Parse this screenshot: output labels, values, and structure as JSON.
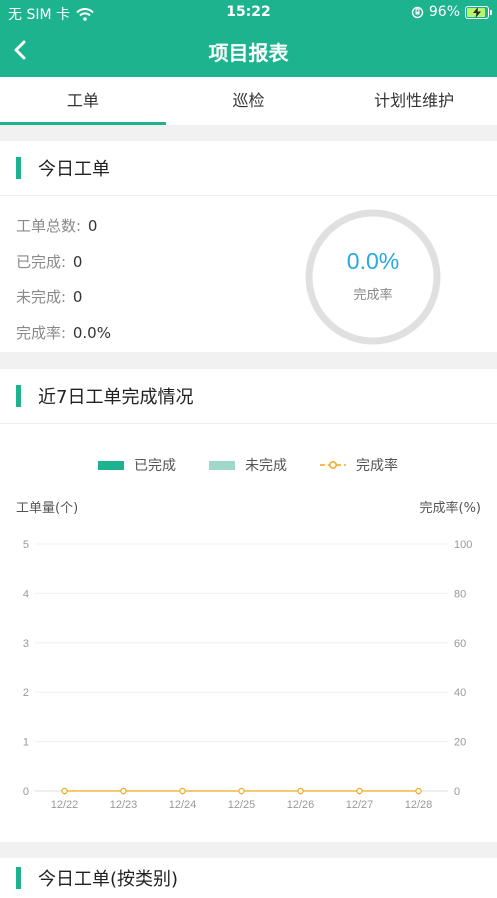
{
  "status_bar": {
    "carrier": "无 SIM 卡",
    "time": "15:22",
    "battery": "96%",
    "battery_level": 0.96
  },
  "nav": {
    "title": "项目报表",
    "back_icon": "chevron-left-icon"
  },
  "tabs": [
    {
      "label": "工单",
      "active": true
    },
    {
      "label": "巡检",
      "active": false
    },
    {
      "label": "计划性维护",
      "active": false
    }
  ],
  "today": {
    "title": "今日工单",
    "rows": [
      {
        "label": "工单总数:",
        "value": "0"
      },
      {
        "label": "已完成:",
        "value": "0"
      },
      {
        "label": "未完成:",
        "value": "0"
      },
      {
        "label": "完成率:",
        "value": "0.0%"
      }
    ],
    "donut": {
      "value": "0.0%",
      "label": "完成率",
      "fraction": 0.0
    }
  },
  "weekly": {
    "title": "近7日工单完成情况",
    "legend": [
      {
        "label": "已完成",
        "color": "#1db38e"
      },
      {
        "label": "未完成",
        "color": "#9ed8cc"
      },
      {
        "label": "完成率",
        "color": "#f5a623"
      }
    ],
    "left_axis_title": "工单量(个)",
    "right_axis_title": "完成率(%)"
  },
  "chart_data": {
    "type": "bar",
    "categories": [
      "12/22",
      "12/23",
      "12/24",
      "12/25",
      "12/26",
      "12/27",
      "12/28"
    ],
    "series": [
      {
        "name": "已完成",
        "type": "bar",
        "axis": "left",
        "values": [
          0,
          0,
          0,
          0,
          0,
          0,
          0
        ]
      },
      {
        "name": "未完成",
        "type": "bar",
        "axis": "left",
        "values": [
          0,
          0,
          0,
          0,
          0,
          0,
          0
        ]
      },
      {
        "name": "完成率",
        "type": "line",
        "axis": "right",
        "values": [
          0,
          0,
          0,
          0,
          0,
          0,
          0
        ]
      }
    ],
    "ylabel": "工单量(个)",
    "ylabel_right": "完成率(%)",
    "ylim": [
      0,
      5
    ],
    "ylim_right": [
      0,
      100
    ],
    "yticks": [
      0,
      1,
      2,
      3,
      4,
      5
    ],
    "yticks_right": [
      0,
      20,
      40,
      60,
      80,
      100
    ],
    "grid": true,
    "legend_position": "top-center"
  },
  "next_card": {
    "title": "今日工单(按类别)"
  },
  "colors": {
    "primary": "#1db38e",
    "rate": "#f5a623",
    "donut_text": "#27a9e1"
  }
}
